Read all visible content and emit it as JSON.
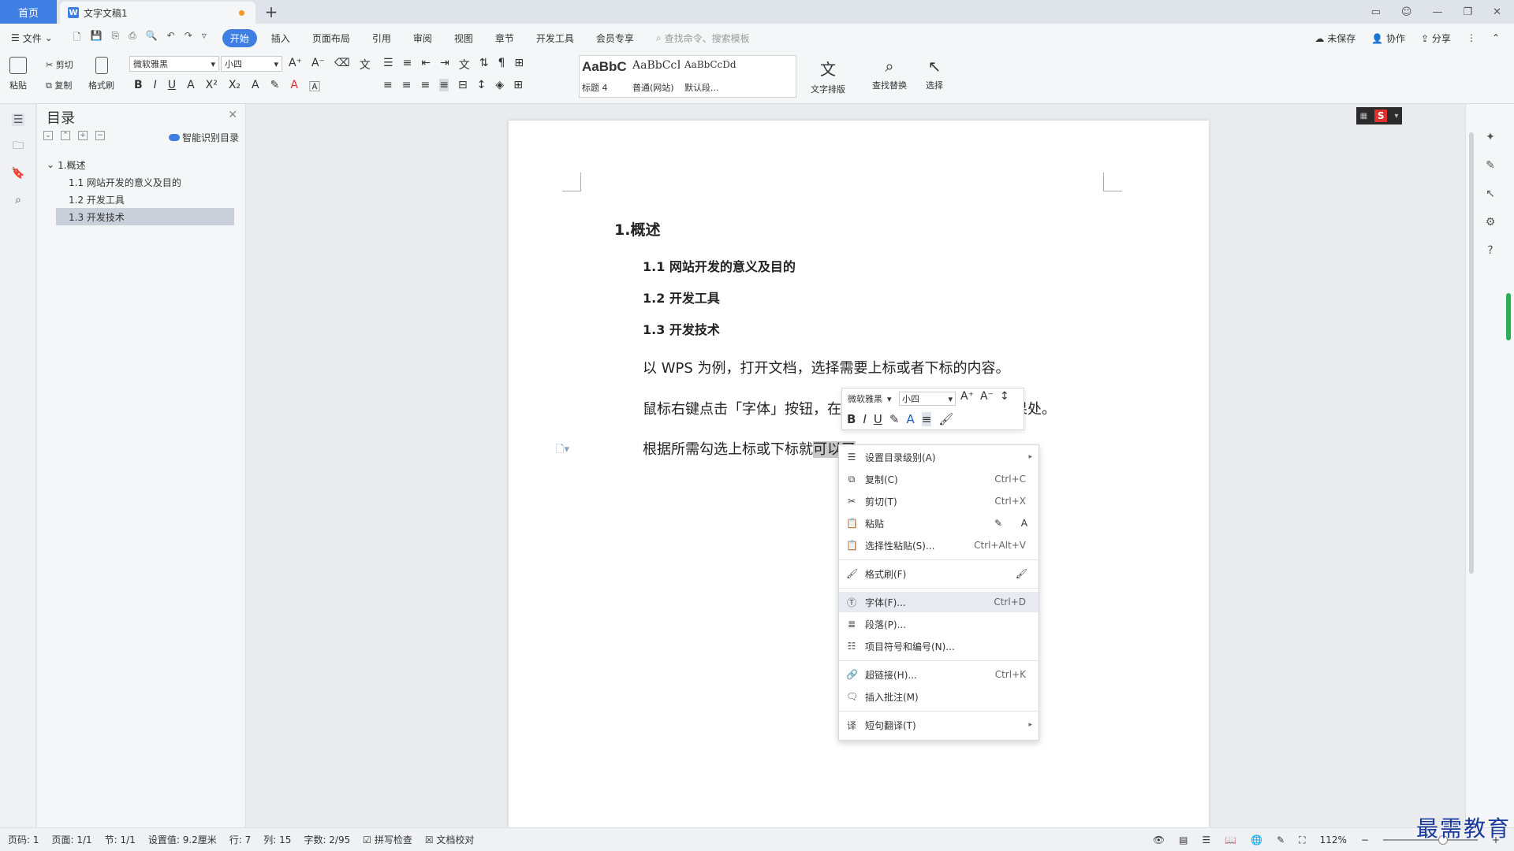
{
  "tabs": {
    "home": "首页",
    "document": "文字文稿1",
    "new_tab": "+"
  },
  "menubar": {
    "file": "文件",
    "items": [
      "开始",
      "插入",
      "页面布局",
      "引用",
      "审阅",
      "视图",
      "章节",
      "开发工具",
      "会员专享"
    ],
    "active": "开始",
    "search_placeholder": "查找命令、搜索模板",
    "unsaved": "未保存",
    "collab": "协作",
    "share": "分享"
  },
  "ribbon": {
    "paste": "粘贴",
    "cut": "剪切",
    "copy": "复制",
    "format_painter": "格式刷",
    "font_name": "微软雅黑",
    "font_size": "小四",
    "styles": [
      {
        "preview": "AaBbC",
        "label": "标题 4"
      },
      {
        "preview": "AaBbCcI",
        "label": "普通(网站)"
      },
      {
        "preview": "AaBbCcDd",
        "label": "默认段..."
      }
    ],
    "text_layout": "文字排版",
    "find_replace": "查找替换",
    "select": "选择"
  },
  "toc": {
    "title": "目录",
    "smart": "智能识别目录",
    "items": [
      {
        "label": "1.概述",
        "level": 1
      },
      {
        "label": "1.1 网站开发的意义及目的",
        "level": 2
      },
      {
        "label": "1.2 开发工具",
        "level": 2
      },
      {
        "label": "1.3 开发技术",
        "level": 2,
        "selected": true
      }
    ]
  },
  "document": {
    "h1": "1.概述",
    "h2_1": "1.1 网站开发的意义及目的",
    "h2_2": "1.2 开发工具",
    "h2_3": "1.3 开发技术",
    "para1": "以 WPS 为例，打开文档，选择需要上标或者下标的内容。",
    "para2_a": "鼠标右键点击「字体」按钮，在",
    "para2_b": "效果处。",
    "para3_a": "根据所需勾选上标或下标就",
    "para3_sel": "可以了",
    "para3_b": "。"
  },
  "mini_toolbar": {
    "font_name": "微软雅黑",
    "font_size": "小四"
  },
  "context_menu": [
    {
      "label": "设置目录级别(A)",
      "icon": "toc-level-icon",
      "submenu": true
    },
    {
      "label": "复制(C)",
      "icon": "copy-icon",
      "shortcut": "Ctrl+C"
    },
    {
      "label": "剪切(T)",
      "icon": "cut-icon",
      "shortcut": "Ctrl+X"
    },
    {
      "label": "粘贴",
      "icon": "paste-icon"
    },
    {
      "label": "选择性粘贴(S)...",
      "icon": "paste-special-icon",
      "shortcut": "Ctrl+Alt+V"
    },
    {
      "label": "格式刷(F)",
      "icon": "format-painter-icon"
    },
    {
      "label": "字体(F)...",
      "icon": "font-icon",
      "shortcut": "Ctrl+D",
      "highlighted": true
    },
    {
      "label": "段落(P)...",
      "icon": "paragraph-icon"
    },
    {
      "label": "项目符号和编号(N)...",
      "icon": "bullets-icon"
    },
    {
      "label": "超链接(H)...",
      "icon": "hyperlink-icon",
      "shortcut": "Ctrl+K"
    },
    {
      "label": "插入批注(M)",
      "icon": "comment-icon"
    },
    {
      "label": "短句翻译(T)",
      "icon": "translate-icon",
      "submenu": true
    }
  ],
  "statusbar": {
    "page_num": "页码: 1",
    "pages": "页面: 1/1",
    "section": "节: 1/1",
    "setting": "设置值: 9.2厘米",
    "row": "行: 7",
    "col": "列: 15",
    "words": "字数: 2/95",
    "spell": "拼写检查",
    "proof": "文档校对",
    "zoom": "112%"
  },
  "watermark": "最需教育",
  "colors": {
    "accent": "#3f7fe4",
    "ime_red": "#e0302c",
    "green": "#2fae5a"
  }
}
